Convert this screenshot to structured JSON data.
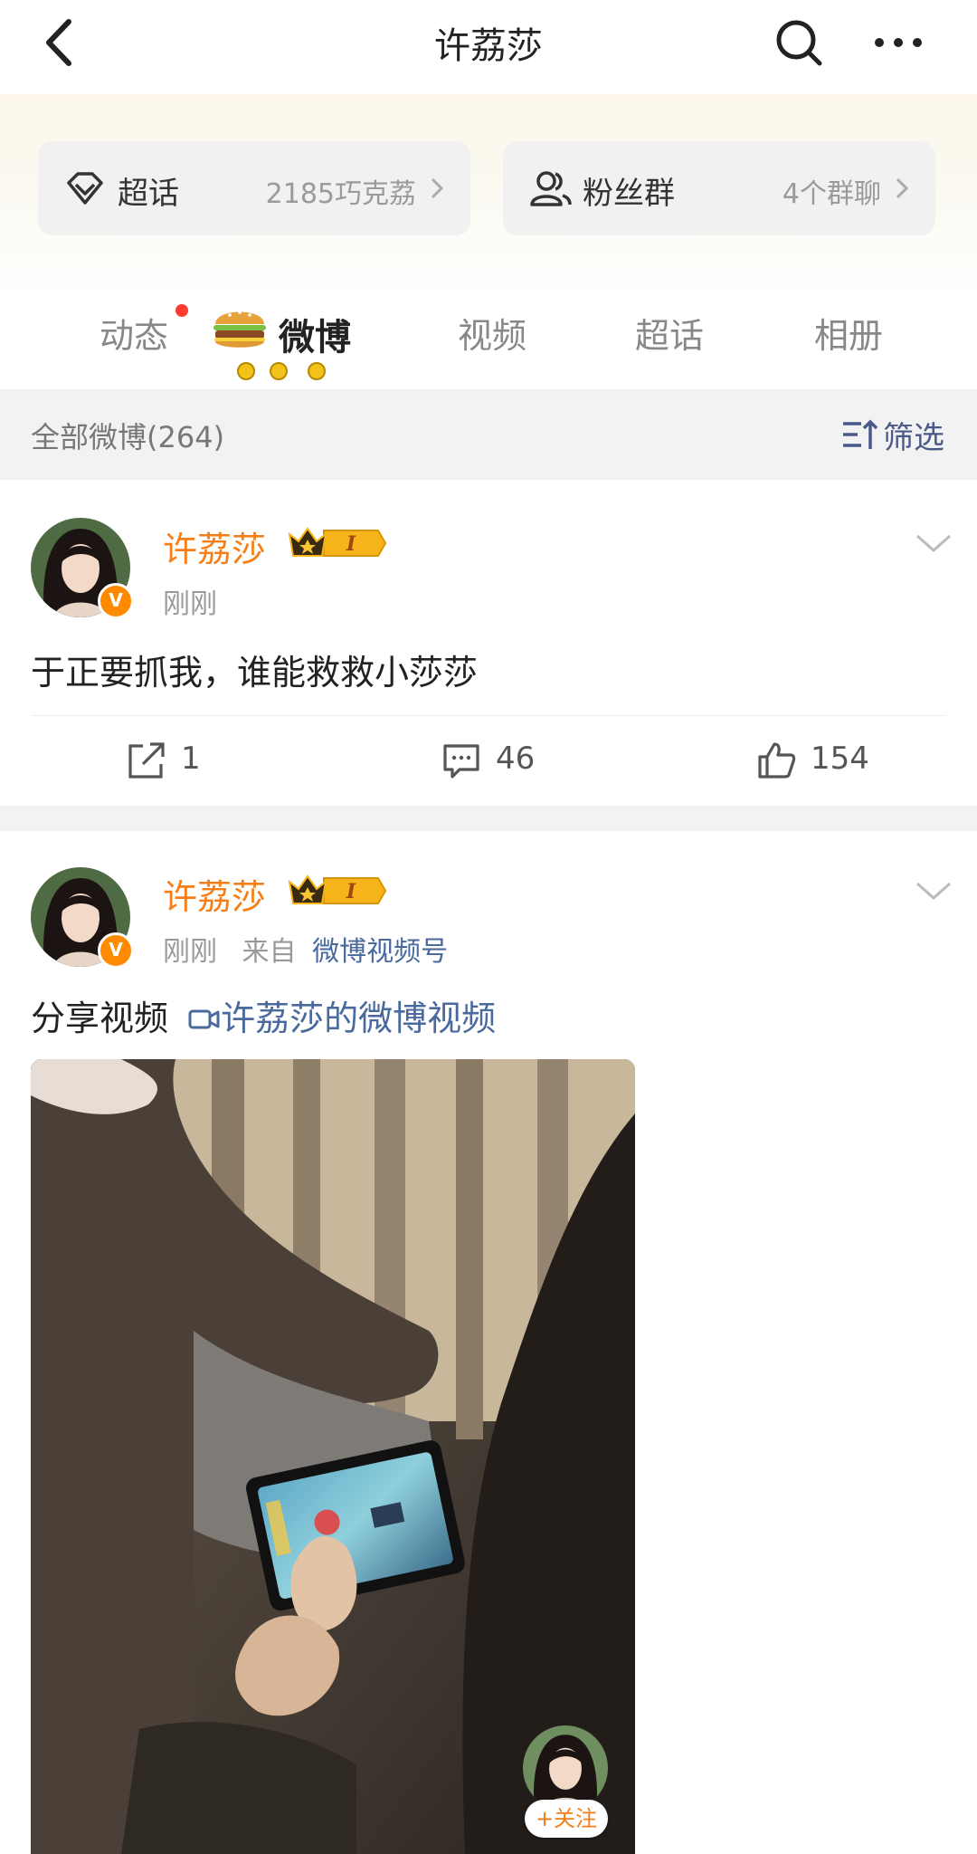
{
  "header": {
    "title": "许荔莎"
  },
  "cards": [
    {
      "label": "超话",
      "value": "2185巧克荔"
    },
    {
      "label": "粉丝群",
      "value": "4个群聊"
    }
  ],
  "tabs": [
    "动态",
    "微博",
    "视频",
    "超话",
    "相册"
  ],
  "filter": {
    "all_label": "全部微博(264)",
    "filter_label": "筛选"
  },
  "posts": [
    {
      "name": "许荔莎",
      "level": "I",
      "time": "刚刚",
      "text": "于正要抓我，谁能救救小莎莎",
      "reposts": "1",
      "comments": "46",
      "likes": "154"
    },
    {
      "name": "许荔莎",
      "level": "I",
      "time": "刚刚",
      "source_prefix": "来自",
      "source": "微博视频号",
      "text": "分享视频",
      "video_link": "许荔莎的微博视频"
    }
  ],
  "video": {
    "follow_label": "+关注"
  },
  "colors": {
    "accent": "#f47e17",
    "link": "#4a6a9e",
    "verified": "#ff8a00"
  }
}
